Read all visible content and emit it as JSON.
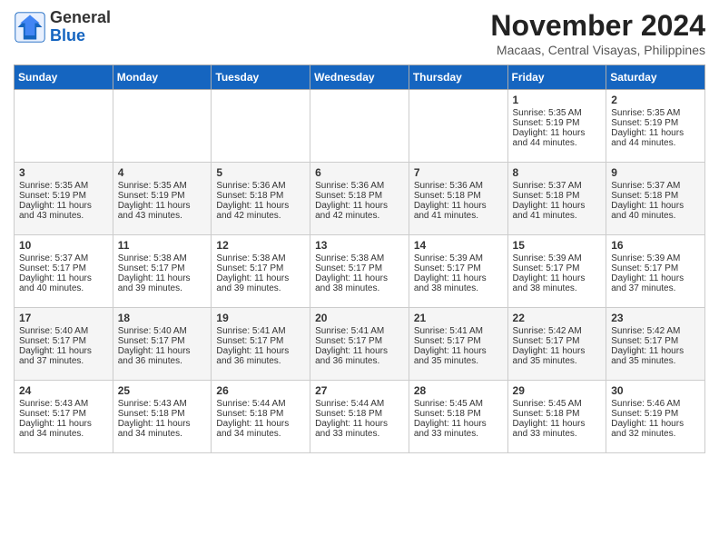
{
  "header": {
    "logo_line1": "General",
    "logo_line2": "Blue",
    "month_year": "November 2024",
    "location": "Macaas, Central Visayas, Philippines"
  },
  "days_of_week": [
    "Sunday",
    "Monday",
    "Tuesday",
    "Wednesday",
    "Thursday",
    "Friday",
    "Saturday"
  ],
  "weeks": [
    [
      {
        "day": "",
        "sunrise": "",
        "sunset": "",
        "daylight": ""
      },
      {
        "day": "",
        "sunrise": "",
        "sunset": "",
        "daylight": ""
      },
      {
        "day": "",
        "sunrise": "",
        "sunset": "",
        "daylight": ""
      },
      {
        "day": "",
        "sunrise": "",
        "sunset": "",
        "daylight": ""
      },
      {
        "day": "",
        "sunrise": "",
        "sunset": "",
        "daylight": ""
      },
      {
        "day": "1",
        "sunrise": "Sunrise: 5:35 AM",
        "sunset": "Sunset: 5:19 PM",
        "daylight": "Daylight: 11 hours and 44 minutes."
      },
      {
        "day": "2",
        "sunrise": "Sunrise: 5:35 AM",
        "sunset": "Sunset: 5:19 PM",
        "daylight": "Daylight: 11 hours and 44 minutes."
      }
    ],
    [
      {
        "day": "3",
        "sunrise": "Sunrise: 5:35 AM",
        "sunset": "Sunset: 5:19 PM",
        "daylight": "Daylight: 11 hours and 43 minutes."
      },
      {
        "day": "4",
        "sunrise": "Sunrise: 5:35 AM",
        "sunset": "Sunset: 5:19 PM",
        "daylight": "Daylight: 11 hours and 43 minutes."
      },
      {
        "day": "5",
        "sunrise": "Sunrise: 5:36 AM",
        "sunset": "Sunset: 5:18 PM",
        "daylight": "Daylight: 11 hours and 42 minutes."
      },
      {
        "day": "6",
        "sunrise": "Sunrise: 5:36 AM",
        "sunset": "Sunset: 5:18 PM",
        "daylight": "Daylight: 11 hours and 42 minutes."
      },
      {
        "day": "7",
        "sunrise": "Sunrise: 5:36 AM",
        "sunset": "Sunset: 5:18 PM",
        "daylight": "Daylight: 11 hours and 41 minutes."
      },
      {
        "day": "8",
        "sunrise": "Sunrise: 5:37 AM",
        "sunset": "Sunset: 5:18 PM",
        "daylight": "Daylight: 11 hours and 41 minutes."
      },
      {
        "day": "9",
        "sunrise": "Sunrise: 5:37 AM",
        "sunset": "Sunset: 5:18 PM",
        "daylight": "Daylight: 11 hours and 40 minutes."
      }
    ],
    [
      {
        "day": "10",
        "sunrise": "Sunrise: 5:37 AM",
        "sunset": "Sunset: 5:17 PM",
        "daylight": "Daylight: 11 hours and 40 minutes."
      },
      {
        "day": "11",
        "sunrise": "Sunrise: 5:38 AM",
        "sunset": "Sunset: 5:17 PM",
        "daylight": "Daylight: 11 hours and 39 minutes."
      },
      {
        "day": "12",
        "sunrise": "Sunrise: 5:38 AM",
        "sunset": "Sunset: 5:17 PM",
        "daylight": "Daylight: 11 hours and 39 minutes."
      },
      {
        "day": "13",
        "sunrise": "Sunrise: 5:38 AM",
        "sunset": "Sunset: 5:17 PM",
        "daylight": "Daylight: 11 hours and 38 minutes."
      },
      {
        "day": "14",
        "sunrise": "Sunrise: 5:39 AM",
        "sunset": "Sunset: 5:17 PM",
        "daylight": "Daylight: 11 hours and 38 minutes."
      },
      {
        "day": "15",
        "sunrise": "Sunrise: 5:39 AM",
        "sunset": "Sunset: 5:17 PM",
        "daylight": "Daylight: 11 hours and 38 minutes."
      },
      {
        "day": "16",
        "sunrise": "Sunrise: 5:39 AM",
        "sunset": "Sunset: 5:17 PM",
        "daylight": "Daylight: 11 hours and 37 minutes."
      }
    ],
    [
      {
        "day": "17",
        "sunrise": "Sunrise: 5:40 AM",
        "sunset": "Sunset: 5:17 PM",
        "daylight": "Daylight: 11 hours and 37 minutes."
      },
      {
        "day": "18",
        "sunrise": "Sunrise: 5:40 AM",
        "sunset": "Sunset: 5:17 PM",
        "daylight": "Daylight: 11 hours and 36 minutes."
      },
      {
        "day": "19",
        "sunrise": "Sunrise: 5:41 AM",
        "sunset": "Sunset: 5:17 PM",
        "daylight": "Daylight: 11 hours and 36 minutes."
      },
      {
        "day": "20",
        "sunrise": "Sunrise: 5:41 AM",
        "sunset": "Sunset: 5:17 PM",
        "daylight": "Daylight: 11 hours and 36 minutes."
      },
      {
        "day": "21",
        "sunrise": "Sunrise: 5:41 AM",
        "sunset": "Sunset: 5:17 PM",
        "daylight": "Daylight: 11 hours and 35 minutes."
      },
      {
        "day": "22",
        "sunrise": "Sunrise: 5:42 AM",
        "sunset": "Sunset: 5:17 PM",
        "daylight": "Daylight: 11 hours and 35 minutes."
      },
      {
        "day": "23",
        "sunrise": "Sunrise: 5:42 AM",
        "sunset": "Sunset: 5:17 PM",
        "daylight": "Daylight: 11 hours and 35 minutes."
      }
    ],
    [
      {
        "day": "24",
        "sunrise": "Sunrise: 5:43 AM",
        "sunset": "Sunset: 5:17 PM",
        "daylight": "Daylight: 11 hours and 34 minutes."
      },
      {
        "day": "25",
        "sunrise": "Sunrise: 5:43 AM",
        "sunset": "Sunset: 5:18 PM",
        "daylight": "Daylight: 11 hours and 34 minutes."
      },
      {
        "day": "26",
        "sunrise": "Sunrise: 5:44 AM",
        "sunset": "Sunset: 5:18 PM",
        "daylight": "Daylight: 11 hours and 34 minutes."
      },
      {
        "day": "27",
        "sunrise": "Sunrise: 5:44 AM",
        "sunset": "Sunset: 5:18 PM",
        "daylight": "Daylight: 11 hours and 33 minutes."
      },
      {
        "day": "28",
        "sunrise": "Sunrise: 5:45 AM",
        "sunset": "Sunset: 5:18 PM",
        "daylight": "Daylight: 11 hours and 33 minutes."
      },
      {
        "day": "29",
        "sunrise": "Sunrise: 5:45 AM",
        "sunset": "Sunset: 5:18 PM",
        "daylight": "Daylight: 11 hours and 33 minutes."
      },
      {
        "day": "30",
        "sunrise": "Sunrise: 5:46 AM",
        "sunset": "Sunset: 5:19 PM",
        "daylight": "Daylight: 11 hours and 32 minutes."
      }
    ]
  ]
}
